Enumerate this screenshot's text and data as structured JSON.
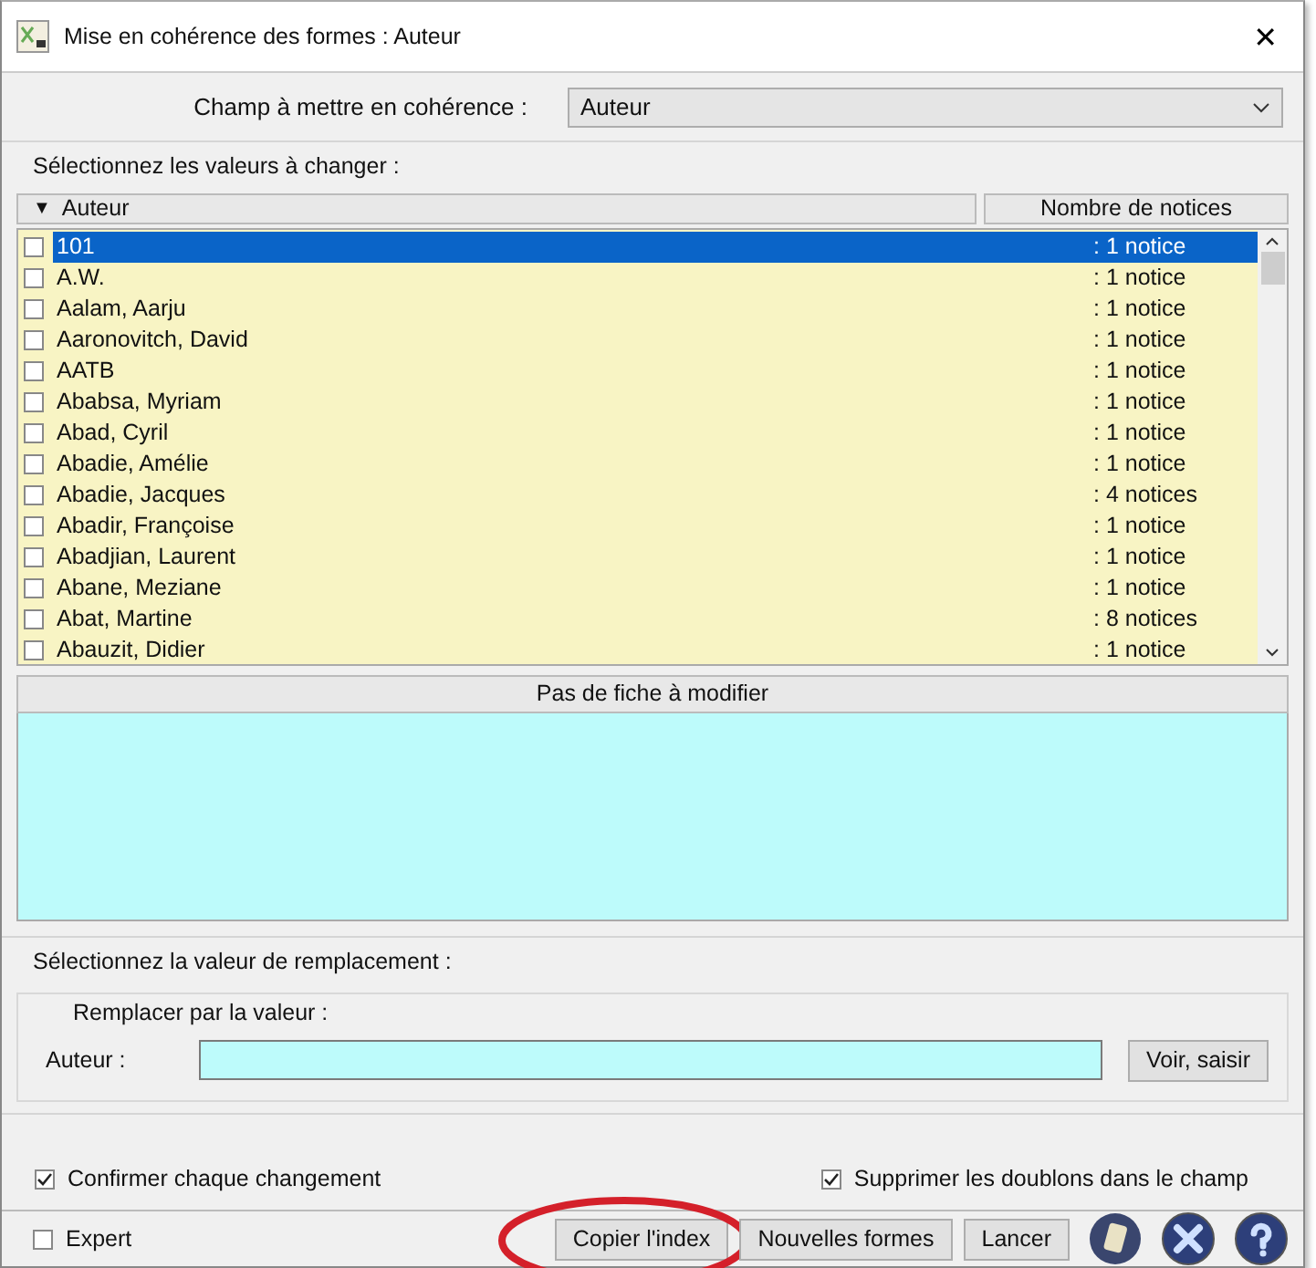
{
  "window": {
    "title": "Mise en cohérence des formes :  Auteur",
    "close": "✕"
  },
  "field_select": {
    "label": "Champ à mettre en cohérence :",
    "value": "Auteur"
  },
  "values_section": {
    "title": "Sélectionnez les valeurs à changer :"
  },
  "table": {
    "columns": [
      {
        "label": "Auteur",
        "sort": "▼"
      },
      {
        "label": "Nombre de notices"
      }
    ],
    "rows": [
      {
        "name": "101",
        "count": ": 1 notice",
        "checked": false,
        "selected": true
      },
      {
        "name": "A.W.",
        "count": ": 1 notice",
        "checked": false,
        "selected": false
      },
      {
        "name": "Aalam, Aarju",
        "count": ": 1 notice",
        "checked": false,
        "selected": false
      },
      {
        "name": "Aaronovitch, David",
        "count": ": 1 notice",
        "checked": false,
        "selected": false
      },
      {
        "name": "AATB",
        "count": ": 1 notice",
        "checked": false,
        "selected": false
      },
      {
        "name": "Ababsa, Myriam",
        "count": ": 1 notice",
        "checked": false,
        "selected": false
      },
      {
        "name": "Abad, Cyril",
        "count": ": 1 notice",
        "checked": false,
        "selected": false
      },
      {
        "name": "Abadie, Amélie",
        "count": ": 1 notice",
        "checked": false,
        "selected": false
      },
      {
        "name": "Abadie, Jacques",
        "count": ": 4 notices",
        "checked": false,
        "selected": false
      },
      {
        "name": "Abadir, Françoise",
        "count": ": 1 notice",
        "checked": false,
        "selected": false
      },
      {
        "name": "Abadjian, Laurent",
        "count": ": 1 notice",
        "checked": false,
        "selected": false
      },
      {
        "name": "Abane, Meziane",
        "count": ": 1 notice",
        "checked": false,
        "selected": false
      },
      {
        "name": "Abat, Martine",
        "count": ": 8 notices",
        "checked": false,
        "selected": false
      },
      {
        "name": "Abauzit, Didier",
        "count": ": 1 notice",
        "checked": false,
        "selected": false
      }
    ]
  },
  "records_panel": {
    "header": "Pas de fiche à modifier"
  },
  "replacement_section": {
    "title": "Sélectionnez la valeur de remplacement :",
    "group_title": "Remplacer par la valeur :",
    "field_label": "Auteur  :",
    "button": "Voir, saisir"
  },
  "options": [
    {
      "label": "Confirmer chaque changement",
      "checked": true
    },
    {
      "label": "Supprimer les doublons dans le champ",
      "checked": true
    }
  ],
  "expert": {
    "label": "Expert",
    "checked": false
  },
  "buttons": [
    {
      "label": "Copier l'index"
    },
    {
      "label": "Nouvelles formes"
    },
    {
      "label": "Lancer"
    }
  ],
  "annotation": {
    "kind": "ellipse"
  },
  "icon_buttons": [
    {
      "kind": "note"
    },
    {
      "kind": "cancel"
    },
    {
      "kind": "help"
    }
  ]
}
